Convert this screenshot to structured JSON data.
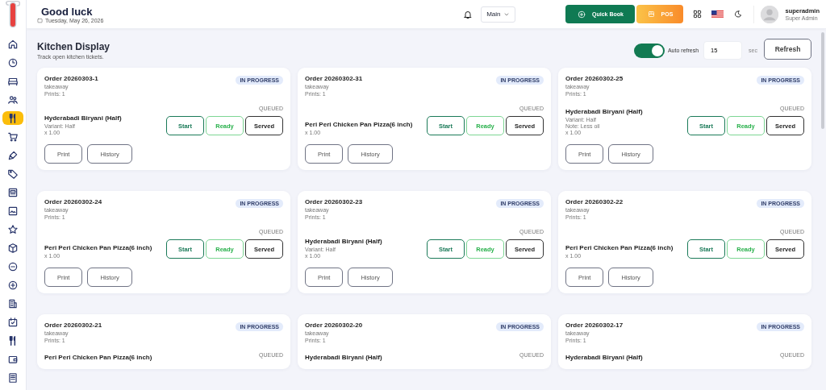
{
  "sidebar": {
    "items": [
      {
        "kind": "home",
        "selected": false
      },
      {
        "kind": "clock",
        "selected": false
      },
      {
        "kind": "bed",
        "selected": false
      },
      {
        "kind": "users",
        "selected": false
      },
      {
        "kind": "utensils",
        "selected": true
      },
      {
        "kind": "cart",
        "selected": false
      },
      {
        "kind": "brush",
        "selected": false
      },
      {
        "kind": "tag",
        "selected": false
      },
      {
        "kind": "news",
        "selected": false
      },
      {
        "kind": "image",
        "selected": false
      },
      {
        "kind": "star",
        "selected": false
      },
      {
        "kind": "box",
        "selected": false
      },
      {
        "kind": "minus",
        "selected": false
      },
      {
        "kind": "plus",
        "selected": false
      },
      {
        "kind": "doc",
        "selected": false
      },
      {
        "kind": "calendar",
        "selected": false
      },
      {
        "kind": "utensils",
        "selected": false
      },
      {
        "kind": "wallet",
        "selected": false
      },
      {
        "kind": "receipt",
        "selected": false
      }
    ]
  },
  "header": {
    "greeting": "Good luck",
    "date": "Tuesday, May 26, 2026",
    "branch": {
      "value": "Main"
    },
    "quick_book": "Quick Book",
    "pos": "POS",
    "user": {
      "name": "superadmin",
      "role": "Super Admin"
    }
  },
  "page": {
    "title": "Kitchen Display",
    "subtitle": "Track open kitchen tickets.",
    "auto_refresh": {
      "label": "Auto refresh",
      "on": true
    },
    "interval": {
      "value": "15",
      "unit": "sec"
    },
    "refresh": "Refresh"
  },
  "tickets": [
    {
      "order": "Order 20260303-1",
      "type": "takeaway",
      "prints": "Prints: 1",
      "status": "IN PROGRESS",
      "items": [
        {
          "name": "Hyderabadi Biryani (Half)",
          "details": [
            "Variant: Half",
            "x 1.00"
          ],
          "state": "QUEUED",
          "actions": [
            {
              "label": "Start",
              "kind": "start"
            },
            {
              "label": "Ready",
              "kind": "ready"
            },
            {
              "label": "Served",
              "kind": "served"
            }
          ]
        }
      ],
      "buttons": [
        "Print",
        "History"
      ]
    },
    {
      "order": "Order 20260302-31",
      "type": "takeaway",
      "prints": "Prints: 1",
      "status": "IN PROGRESS",
      "items": [
        {
          "name": "Peri Peri Chicken Pan Pizza(6 inch)",
          "details": [
            "x 1.00"
          ],
          "state": "QUEUED",
          "actions": [
            {
              "label": "Start",
              "kind": "start"
            },
            {
              "label": "Ready",
              "kind": "ready"
            },
            {
              "label": "Served",
              "kind": "served"
            }
          ]
        }
      ],
      "buttons": [
        "Print",
        "History"
      ]
    },
    {
      "order": "Order 20260302-25",
      "type": "takeaway",
      "prints": "Prints: 1",
      "status": "IN PROGRESS",
      "items": [
        {
          "name": "Hyderabadi Biryani (Half)",
          "details": [
            "Variant: Half",
            "Note: Less oil",
            "x 1.00"
          ],
          "state": "QUEUED",
          "actions": [
            {
              "label": "Start",
              "kind": "start"
            },
            {
              "label": "Ready",
              "kind": "ready"
            },
            {
              "label": "Served",
              "kind": "served"
            }
          ]
        }
      ],
      "buttons": [
        "Print",
        "History"
      ]
    },
    {
      "order": "Order 20260302-24",
      "type": "takeaway",
      "prints": "Prints: 1",
      "status": "IN PROGRESS",
      "items": [
        {
          "name": "Peri Peri Chicken Pan Pizza(6 inch)",
          "details": [
            "x 1.00"
          ],
          "state": "QUEUED",
          "actions": [
            {
              "label": "Start",
              "kind": "start"
            },
            {
              "label": "Ready",
              "kind": "ready"
            },
            {
              "label": "Served",
              "kind": "served"
            }
          ]
        }
      ],
      "buttons": [
        "Print",
        "History"
      ]
    },
    {
      "order": "Order 20260302-23",
      "type": "takeaway",
      "prints": "Prints: 1",
      "status": "IN PROGRESS",
      "items": [
        {
          "name": "Hyderabadi Biryani (Half)",
          "details": [
            "Variant: Half",
            "x 1.00"
          ],
          "state": "QUEUED",
          "actions": [
            {
              "label": "Start",
              "kind": "start"
            },
            {
              "label": "Ready",
              "kind": "ready"
            },
            {
              "label": "Served",
              "kind": "served"
            }
          ]
        }
      ],
      "buttons": [
        "Print",
        "History"
      ]
    },
    {
      "order": "Order 20260302-22",
      "type": "takeaway",
      "prints": "Prints: 1",
      "status": "IN PROGRESS",
      "items": [
        {
          "name": "Peri Peri Chicken Pan Pizza(6 inch)",
          "details": [
            "x 1.00"
          ],
          "state": "QUEUED",
          "actions": [
            {
              "label": "Start",
              "kind": "start"
            },
            {
              "label": "Ready",
              "kind": "ready"
            },
            {
              "label": "Served",
              "kind": "served"
            }
          ]
        }
      ],
      "buttons": [
        "Print",
        "History"
      ]
    },
    {
      "order": "Order 20260302-21",
      "type": "takeaway",
      "prints": "Prints: 1",
      "status": "IN PROGRESS",
      "items": [
        {
          "name": "Peri Peri Chicken Pan Pizza(6 inch)",
          "state": "QUEUED"
        }
      ]
    },
    {
      "order": "Order 20260302-20",
      "type": "takeaway",
      "prints": "Prints: 1",
      "status": "IN PROGRESS",
      "items": [
        {
          "name": "Hyderabadi Biryani (Half)",
          "state": "QUEUED"
        }
      ]
    },
    {
      "order": "Order 20260302-17",
      "type": "takeaway",
      "prints": "Prints: 1",
      "status": "IN PROGRESS",
      "items": [
        {
          "name": "Hyderabadi Biryani (Half)",
          "state": "QUEUED"
        }
      ]
    }
  ]
}
